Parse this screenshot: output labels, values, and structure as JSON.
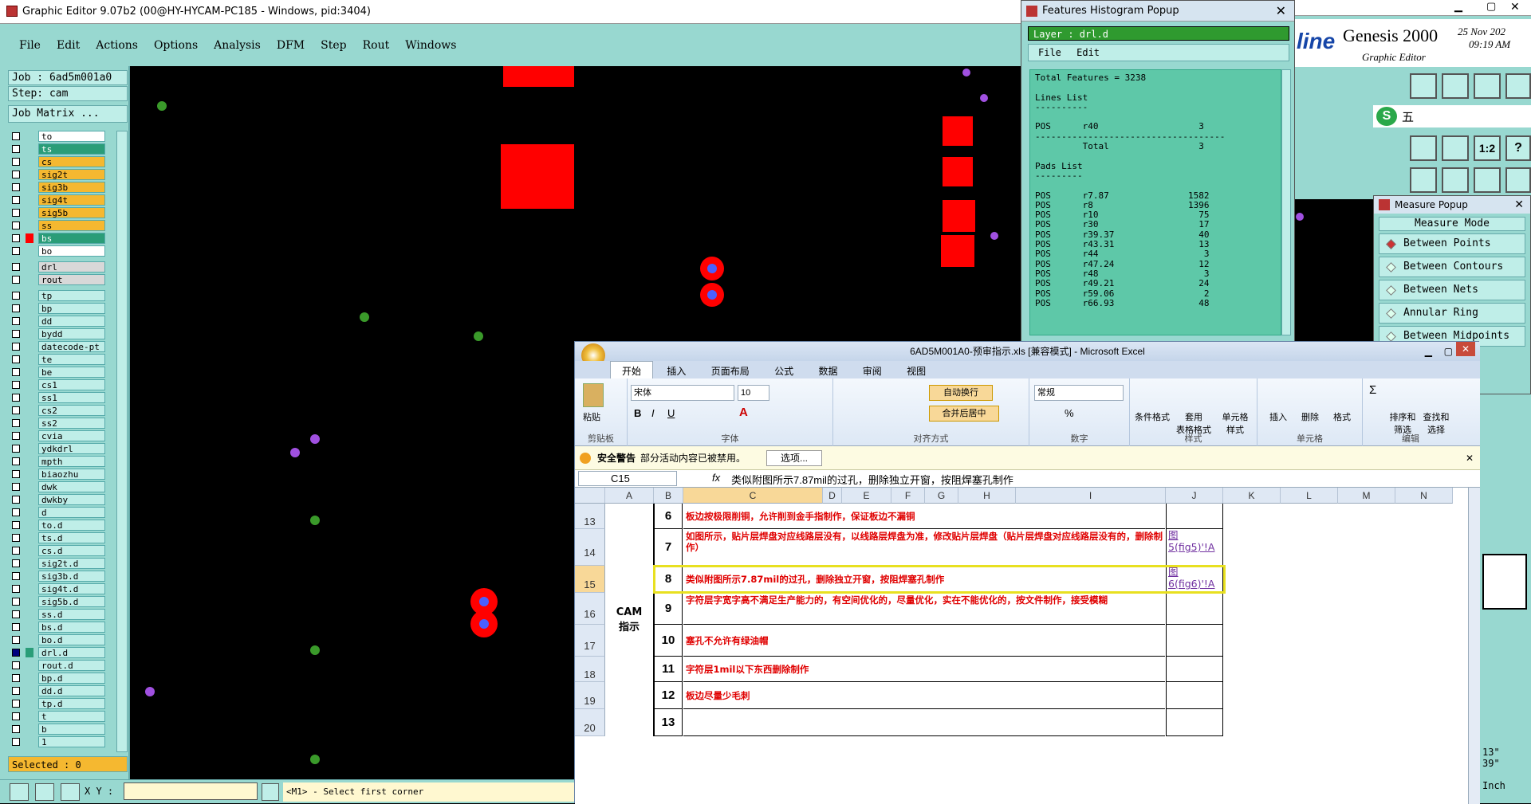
{
  "editor": {
    "title": "Graphic Editor 9.07b2 (00@HY-HYCAM-PC185 - Windows, pid:3404)",
    "menu": [
      "File",
      "Edit",
      "Actions",
      "Options",
      "Analysis",
      "DFM",
      "Step",
      "Rout",
      "Windows"
    ],
    "job_label": "Job : ",
    "job_value": "6ad5m001a0",
    "step_label": "Step: ",
    "step_value": "cam",
    "job_matrix": "Job Matrix ...",
    "layers": [
      {
        "name": "to",
        "style": "white",
        "color": "#ffffff"
      },
      {
        "name": "ts",
        "style": "hl",
        "color": "#2a9d78"
      },
      {
        "name": "cs",
        "style": "warm",
        "color": "#f5b830"
      },
      {
        "name": "sig2t",
        "style": "warm",
        "color": "#f5b830"
      },
      {
        "name": "sig3b",
        "style": "warm",
        "color": "#f5b830"
      },
      {
        "name": "sig4t",
        "style": "warm",
        "color": "#f5b830"
      },
      {
        "name": "sig5b",
        "style": "warm",
        "color": "#f5b830"
      },
      {
        "name": "ss",
        "style": "warm",
        "color": "#f5b830"
      },
      {
        "name": "bs",
        "style": "hl",
        "color": "#2a9d78"
      },
      {
        "name": "bo",
        "style": "white",
        "color": "#ffffff"
      },
      {
        "name": "drl",
        "style": "grey",
        "color": "#d8d8d8"
      },
      {
        "name": "rout",
        "style": "grey",
        "color": "#d8d8d8"
      },
      {
        "name": "tp"
      },
      {
        "name": "bp"
      },
      {
        "name": "dd"
      },
      {
        "name": "bydd"
      },
      {
        "name": "datecode-pt"
      },
      {
        "name": "te"
      },
      {
        "name": "be"
      },
      {
        "name": "cs1"
      },
      {
        "name": "ss1"
      },
      {
        "name": "cs2"
      },
      {
        "name": "ss2"
      },
      {
        "name": "cvia"
      },
      {
        "name": "ydkdrl"
      },
      {
        "name": "mpth"
      },
      {
        "name": "biaozhu"
      },
      {
        "name": "dwk"
      },
      {
        "name": "dwkby"
      },
      {
        "name": "d"
      },
      {
        "name": "to.d"
      },
      {
        "name": "ts.d"
      },
      {
        "name": "cs.d"
      },
      {
        "name": "sig2t.d"
      },
      {
        "name": "sig3b.d"
      },
      {
        "name": "sig4t.d"
      },
      {
        "name": "sig5b.d"
      },
      {
        "name": "ss.d"
      },
      {
        "name": "bs.d"
      },
      {
        "name": "bo.d"
      },
      {
        "name": "drl.d"
      },
      {
        "name": "rout.d"
      },
      {
        "name": "bp.d"
      },
      {
        "name": "dd.d"
      },
      {
        "name": "tp.d"
      },
      {
        "name": "t"
      },
      {
        "name": "b"
      },
      {
        "name": "1"
      }
    ],
    "selected": "Selected : 0",
    "xy_label": "X Y :",
    "prompt": "<M1> - Select first corner"
  },
  "histogram": {
    "title": "Features Histogram Popup",
    "layer": "Layer :  drl.d",
    "menu": "File Edit",
    "body": "Total Features = 3238\n\nLines List\n----------\n\nPOS      r40                   3\n------------------------------------\n         Total                 3\n\nPads List\n---------\n\nPOS      r7.87               1582\nPOS      r8                  1396\nPOS      r10                   75\nPOS      r30                   17\nPOS      r39.37                40\nPOS      r43.31                13\nPOS      r44                    3\nPOS      r47.24                12\nPOS      r48                    3\nPOS      r49.21                24\nPOS      r59.06                 2\nPOS      r66.93                48"
  },
  "genesis": {
    "brand": "line",
    "product": "Genesis 2000",
    "subtitle": "Graphic Editor",
    "date": "25 Nov 202",
    "time": "09:19 AM"
  },
  "measure": {
    "title": "Measure Popup",
    "mode": "Measure Mode",
    "buttons": [
      "Between Points",
      "Between Contours",
      "Between Nets",
      "Annular Ring",
      "Between Midpoints"
    ]
  },
  "side_readout": {
    "v1": "13\"",
    "v2": "39\"",
    "unit": "Inch"
  },
  "excel": {
    "title": "6AD5M001A0-预审指示.xls [兼容模式] - Microsoft Excel",
    "tabs": [
      "开始",
      "插入",
      "页面布局",
      "公式",
      "数据",
      "审阅",
      "视图"
    ],
    "ribbon": {
      "paste": "粘贴",
      "clipboard": "剪贴板",
      "font_name": "宋体",
      "font_size": "10",
      "font": "字体",
      "wrap": "自动换行",
      "merge": "合并后居中",
      "align": "对齐方式",
      "numfmt": "常规",
      "number": "数字",
      "cond": "条件格式",
      "table": "套用\n表格格式",
      "cellstyle": "单元格\n样式",
      "styles": "样式",
      "insert": "插入",
      "delete": "删除",
      "format": "格式",
      "cells": "单元格",
      "sort": "排序和\n筛选",
      "find": "查找和\n选择",
      "edit": "编辑"
    },
    "security": "安全警告",
    "security_msg": "部分活动内容已被禁用。",
    "options": "选项...",
    "namebox": "C15",
    "formula": "类似附图所示7.87mil的过孔，删除独立开窗，按阻焊塞孔制作",
    "columns": [
      "A",
      "B",
      "C",
      "D",
      "E",
      "F",
      "G",
      "H",
      "I",
      "J",
      "K",
      "L",
      "M",
      "N"
    ],
    "section_label": "CAM\n指示",
    "rows": [
      {
        "row": "13",
        "num": "6",
        "text": "板边按极限削铜，允许削到金手指制作，保证板边不漏铜",
        "link": ""
      },
      {
        "row": "14",
        "num": "7",
        "text": "如图所示，贴片层焊盘对应线路层没有，以线路层焊盘为准，修改贴片层焊盘（贴片层焊盘对应线路层没有的，删除制作）",
        "link": "图5(fig5)'!A"
      },
      {
        "row": "15",
        "num": "8",
        "text": "类似附图所示7.87mil的过孔，删除独立开窗，按阻焊塞孔制作",
        "link": "图6(fig6)'!A"
      },
      {
        "row": "16",
        "num": "9",
        "text": "字符层字宽字高不满足生产能力的，有空间优化的，尽量优化，实在不能优化的，按文件制作，接受模糊",
        "link": ""
      },
      {
        "row": "17",
        "num": "10",
        "text": "塞孔不允许有绿油帽",
        "link": ""
      },
      {
        "row": "18",
        "num": "11",
        "text": "字符层1mil以下东西删除制作",
        "link": ""
      },
      {
        "row": "19",
        "num": "12",
        "text": "板边尽量少毛刺",
        "link": ""
      },
      {
        "row": "20",
        "num": "13",
        "text": "",
        "link": ""
      }
    ]
  }
}
